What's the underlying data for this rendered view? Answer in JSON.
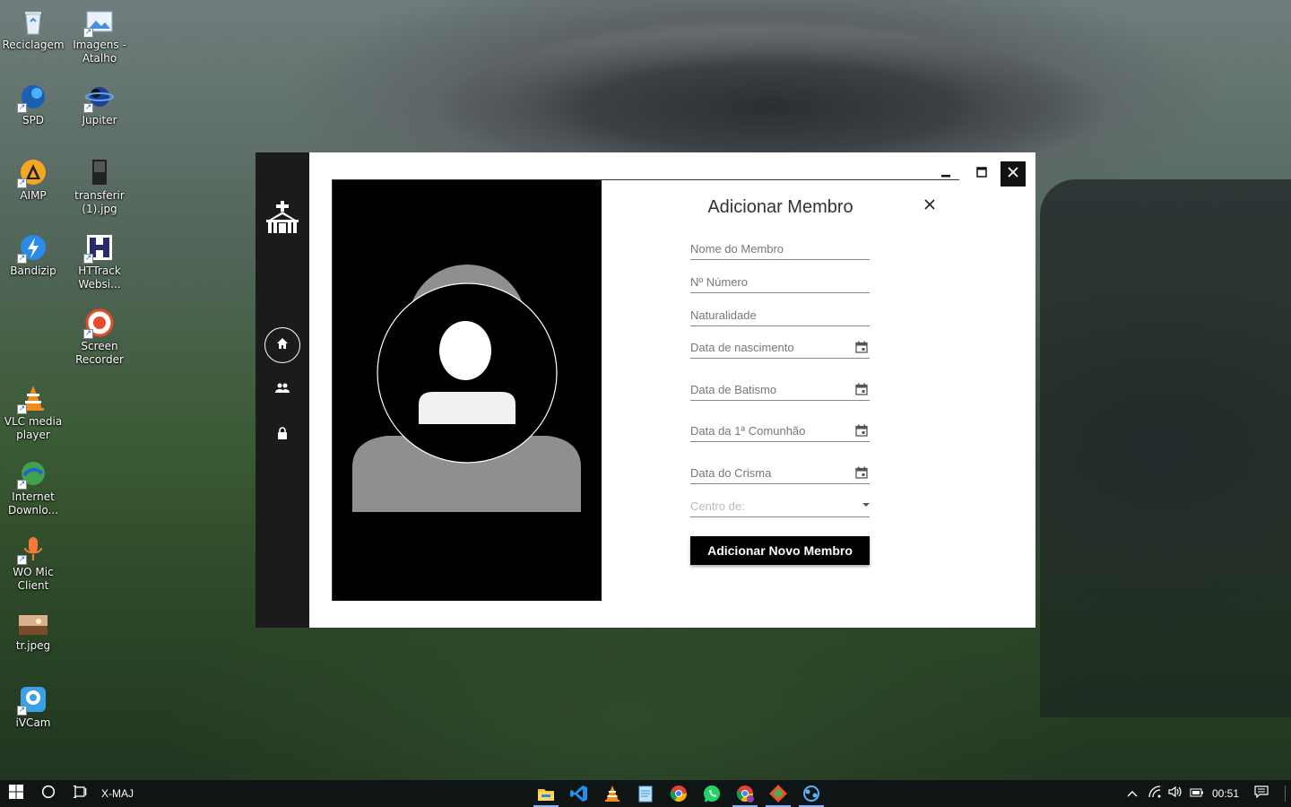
{
  "desktop": {
    "icons": [
      {
        "label": "Reciclagem",
        "icon": "recycle-bin-icon"
      },
      {
        "label": "Imagens - Atalho",
        "icon": "images-shortcut-icon"
      },
      {
        "label": "SPD",
        "icon": "spd-icon"
      },
      {
        "label": "Jupiter",
        "icon": "jupiter-icon"
      },
      {
        "label": "AIMP",
        "icon": "aimp-icon"
      },
      {
        "label": "transferir (1).jpg",
        "icon": "image-file-icon"
      },
      {
        "label": "Bandizip",
        "icon": "bandizip-icon"
      },
      {
        "label": "HTTrack Websi...",
        "icon": "httrack-icon"
      },
      {
        "label": "Screen Recorder",
        "icon": "screen-recorder-icon"
      },
      {
        "label": "VLC media player",
        "icon": "vlc-icon"
      },
      {
        "label": "Internet Downlo...",
        "icon": "internet-download-manager-icon"
      },
      {
        "label": "WO Mic Client",
        "icon": "microphone-icon"
      },
      {
        "label": "tr.jpeg",
        "icon": "image-file-icon"
      },
      {
        "label": "iVCam",
        "icon": "ivcam-icon"
      }
    ]
  },
  "app": {
    "sidebar": {
      "logo": "church-icon",
      "nav": [
        {
          "icon": "home-icon",
          "active": true
        },
        {
          "icon": "people-icon",
          "active": false
        },
        {
          "icon": "lock-icon",
          "active": false
        }
      ]
    },
    "window_controls": {
      "minimize": "minimize-icon",
      "maximize": "maximize-icon",
      "close": "close-icon"
    }
  },
  "modal": {
    "title": "Adicionar Membro",
    "close_icon": "close-icon",
    "fields": {
      "nome": "Nome do Membro",
      "numero": "Nº Número",
      "naturalidade": "Naturalidade",
      "nascimento": "Data de nascimento",
      "batismo": "Data de Batismo",
      "comunhao": "Data da 1ª Comunhão",
      "crisma": "Data do Crisma",
      "centro": "Centro de:"
    },
    "submit_label": "Adicionar Novo Membro"
  },
  "taskbar": {
    "search_text": "X-MAJ",
    "apps": [
      "file-explorer-icon",
      "vscode-icon",
      "vlc-icon",
      "notepad-icon",
      "chrome-icon",
      "whatsapp-icon",
      "chrome-alt-icon",
      "git-icon",
      "network-app-icon"
    ],
    "clock": "00:51"
  },
  "colors": {
    "sidebar": "#1b1b1b",
    "accent": "#000000",
    "taskbar": "#0f1414"
  }
}
